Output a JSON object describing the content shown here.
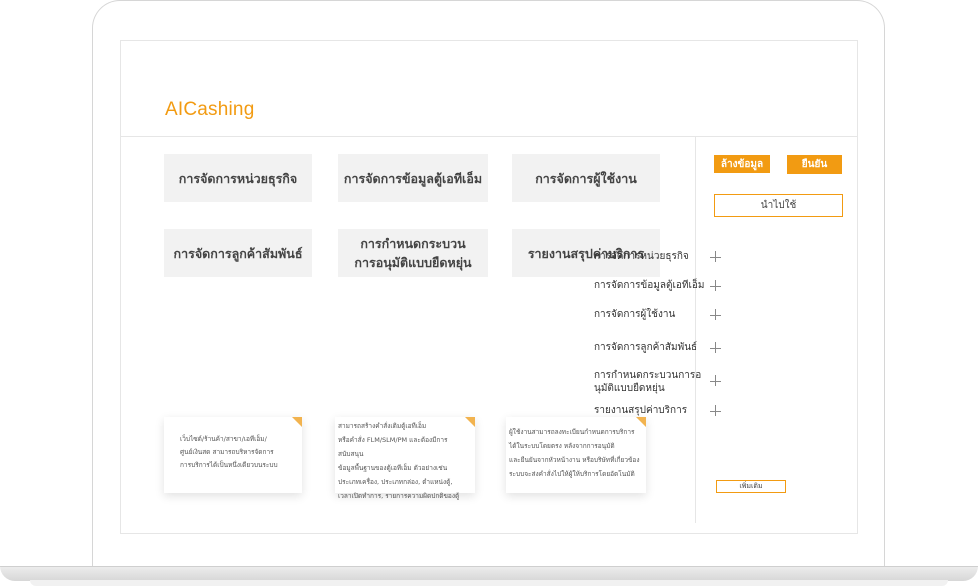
{
  "app": {
    "title": "AICashing"
  },
  "tiles": [
    {
      "label": "การจัดการหน่วยธุรกิจ"
    },
    {
      "label": "การจัดการข้อมูลตู้เอทีเอ็ม"
    },
    {
      "label": "การจัดการผู้ใช้งาน"
    },
    {
      "label": "การจัดการลูกค้าสัมพันธ์"
    },
    {
      "line1": "การกำหนดกระบวน",
      "line2": "การอนุมัติแบบยืดหยุ่น"
    },
    {
      "label": "รายงานสรุปค่าบริการ"
    }
  ],
  "cards": [
    {
      "line1": "เว็บไซต์/ร้านค้า/สาขา/เอทีเอ็ม/",
      "line2": "ศูนย์เงินสด สามารถบริหารจัดการ",
      "line3": "การบริการได้เป็นหนึ่งเดียวบนระบบ"
    },
    {
      "line1": "สามารถสร้างคำสั่งเติมตู้เอทีเอ็ม",
      "line2": "หรือคำสั่ง FLM/SLM/PM และต้องมีการสนับสนุน",
      "line3": "ข้อมูลพื้นฐานของตู้เอทีเอ็ม ตัวอย่างเช่น",
      "line4": "ประเภทเครื่อง, ประเภทกล่อง, ตำแหน่งตู้,",
      "line5": "เวลาเปิดทำการ, รายการความผิดปกติของตู้"
    },
    {
      "line1": "ผู้ใช้งานสามารถลงทะเบียนกำหนดการบริการ",
      "line2": "ได้ในระบบโดยตรง หลังจากการอนุมัติ",
      "line3": "และยืนยันจากหัวหน้างาน หรือบริษัทที่เกี่ยวข้อง",
      "line4": "ระบบจะส่งคำสั่งไปให้ผู้ให้บริการโดยอัตโนมัติ"
    }
  ],
  "sidebar": {
    "clear_label": "ล้างข้อมูล",
    "confirm_label": "ยืนยัน",
    "apply_label": "นำไปใช้",
    "items": [
      {
        "label": "การจัดการหน่วยธุรกิจ"
      },
      {
        "label": "การจัดการข้อมูลตู้เอทีเอ็ม"
      },
      {
        "label": "การจัดการผู้ใช้งาน"
      },
      {
        "label": "การจัดการลูกค้าสัมพันธ์"
      },
      {
        "line1": "การกำหนดกระบวนการอ",
        "line2": "นุมัติแบบยืดหยุ่น"
      },
      {
        "label": "รายงานสรุปค่าบริการ"
      }
    ],
    "more_label": "เพิ่มเติม",
    "icons": {
      "expand": "plus-icon"
    }
  },
  "colors": {
    "accent": "#f29b12",
    "tile_bg": "#f2f2f2"
  }
}
